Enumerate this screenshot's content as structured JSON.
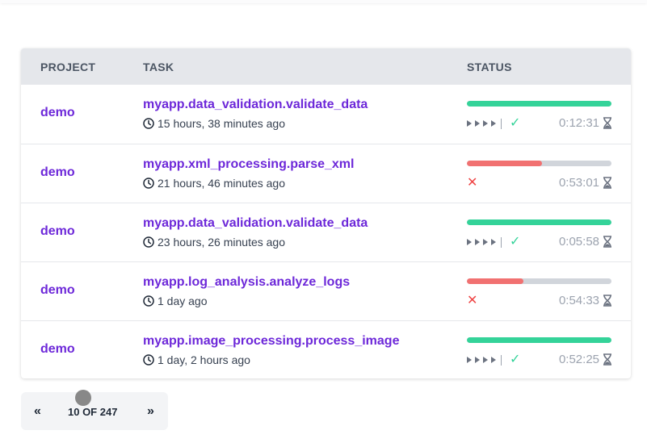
{
  "table": {
    "headers": {
      "project": "PROJECT",
      "task": "TASK",
      "status": "STATUS"
    },
    "rows": [
      {
        "project": "demo",
        "task": "myapp.data_validation.validate_data",
        "time": "15 hours, 38 minutes ago",
        "progress": 1.0,
        "result": "success",
        "duration": "0:12:31"
      },
      {
        "project": "demo",
        "task": "myapp.xml_processing.parse_xml",
        "time": "21 hours, 46 minutes ago",
        "progress": 0.52,
        "result": "failure",
        "duration": "0:53:01"
      },
      {
        "project": "demo",
        "task": "myapp.data_validation.validate_data",
        "time": "23 hours, 26 minutes ago",
        "progress": 1.0,
        "result": "success",
        "duration": "0:05:58"
      },
      {
        "project": "demo",
        "task": "myapp.log_analysis.analyze_logs",
        "time": "1 day ago",
        "progress": 0.39,
        "result": "failure",
        "duration": "0:54:33"
      },
      {
        "project": "demo",
        "task": "myapp.image_processing.process_image",
        "time": "1 day, 2 hours ago",
        "progress": 1.0,
        "result": "success",
        "duration": "0:52:25"
      }
    ]
  },
  "pagination": {
    "prev": "«",
    "next": "»",
    "info": "10 OF 247"
  },
  "colors": {
    "success": "#34d399",
    "failure": "#f17171",
    "link": "#6d28d9",
    "track": "#d1d5db"
  },
  "icons": {
    "time": "clock-icon",
    "duration": "hourglass-icon",
    "success": "check-icon",
    "failure": "x-icon",
    "steps": "play-icon"
  }
}
